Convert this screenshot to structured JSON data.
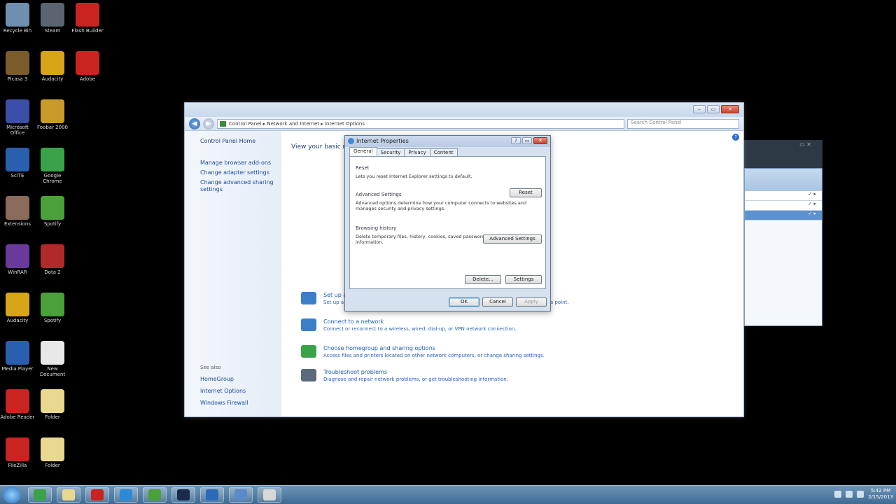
{
  "desktop": {
    "icons": [
      {
        "label": "Recycle Bin",
        "color": "#6f8fb0"
      },
      {
        "label": "Steam",
        "color": "#5b6470"
      },
      {
        "label": "Flash Builder",
        "color": "#c9241f"
      },
      {
        "label": "Picasa 3",
        "color": "#7a5b2a"
      },
      {
        "label": "Audacity",
        "color": "#d8a418"
      },
      {
        "label": "Adobe",
        "color": "#c9241f"
      },
      {
        "label": "Microsoft Office",
        "color": "#3a4fa8"
      },
      {
        "label": "Foobar 2000",
        "color": "#c89a2a"
      },
      {
        "label": "SciTE",
        "color": "#2a5fb0"
      },
      {
        "label": "Google Chrome",
        "color": "#3aa34a"
      },
      {
        "label": "Extensions",
        "color": "#8a6a5a"
      },
      {
        "label": "Spotify",
        "color": "#4aa03a"
      },
      {
        "label": "WinRAR",
        "color": "#6a3a9a"
      },
      {
        "label": "Dota 2",
        "color": "#b02a2a"
      },
      {
        "label": "Audacity",
        "color": "#d8a418"
      },
      {
        "label": "Spotify",
        "color": "#4aa03a"
      },
      {
        "label": "Media Player",
        "color": "#2a5fb0"
      },
      {
        "label": "New Document",
        "color": "#e8e8e8"
      },
      {
        "label": "Adobe Reader",
        "color": "#c9241f"
      },
      {
        "label": "Folder",
        "color": "#e8d890"
      },
      {
        "label": "FileZilla",
        "color": "#c9241f"
      },
      {
        "label": "Folder",
        "color": "#e8d890"
      }
    ]
  },
  "control_panel": {
    "address": "Control Panel ▸ Network and Internet ▸ Internet Options",
    "search_placeholder": "Search Control Panel",
    "sidebar": {
      "home": "Control Panel Home",
      "links": [
        "Manage browser add-ons",
        "Change adapter settings",
        "Change advanced sharing settings"
      ],
      "see_also_title": "See also",
      "see_also_links": [
        "HomeGroup",
        "Internet Options",
        "Windows Firewall"
      ]
    },
    "main": {
      "heading": "View your basic network information and set up connections",
      "sections": [
        {
          "title": "Set up a new connection or network",
          "desc": "Set up a wireless, broadband, dial-up, ad hoc, or VPN connection; or set up a router or access point.",
          "color": "#3a7fc8"
        },
        {
          "title": "Connect to a network",
          "desc": "Connect or reconnect to a wireless, wired, dial-up, or VPN network connection.",
          "color": "#3a7fc8"
        },
        {
          "title": "Choose homegroup and sharing options",
          "desc": "Access files and printers located on other network computers, or change sharing settings.",
          "color": "#3aa34a"
        },
        {
          "title": "Troubleshoot problems",
          "desc": "Diagnose and repair network problems, or get troubleshooting information.",
          "color": "#5a6a7a"
        }
      ]
    }
  },
  "dialog": {
    "title": "Internet Properties",
    "tabs": [
      "General",
      "Security",
      "Privacy",
      "Content"
    ],
    "groups": [
      {
        "title": "Reset",
        "text": "Lets you reset Internet Explorer settings to default."
      },
      {
        "title": "Advanced Settings",
        "text": "Advanced options determine how your computer connects to websites and manages security and privacy settings."
      },
      {
        "title": "Browsing history",
        "text": "Delete temporary files, history, cookies, saved passwords, and web form information."
      }
    ],
    "buttons": {
      "reset": "Reset",
      "advanced": "Advanced Settings",
      "delete": "Delete...",
      "settings": "Settings",
      "ok": "OK",
      "cancel": "Cancel",
      "apply": "Apply"
    }
  },
  "taskbar": {
    "apps": [
      {
        "name": "chrome",
        "color": "#3aa34a"
      },
      {
        "name": "explorer",
        "color": "#e8d890"
      },
      {
        "name": "flash",
        "color": "#c9241f"
      },
      {
        "name": "ie",
        "color": "#2a8ad8"
      },
      {
        "name": "spotify",
        "color": "#4aa03a"
      },
      {
        "name": "media",
        "color": "#1a2a4a"
      },
      {
        "name": "network",
        "color": "#2a6ab8"
      },
      {
        "name": "monitor",
        "color": "#5a8ac8"
      },
      {
        "name": "explorer2",
        "color": "#d8d8d8"
      }
    ],
    "time": "5:42 PM",
    "date": "2/15/2013"
  }
}
